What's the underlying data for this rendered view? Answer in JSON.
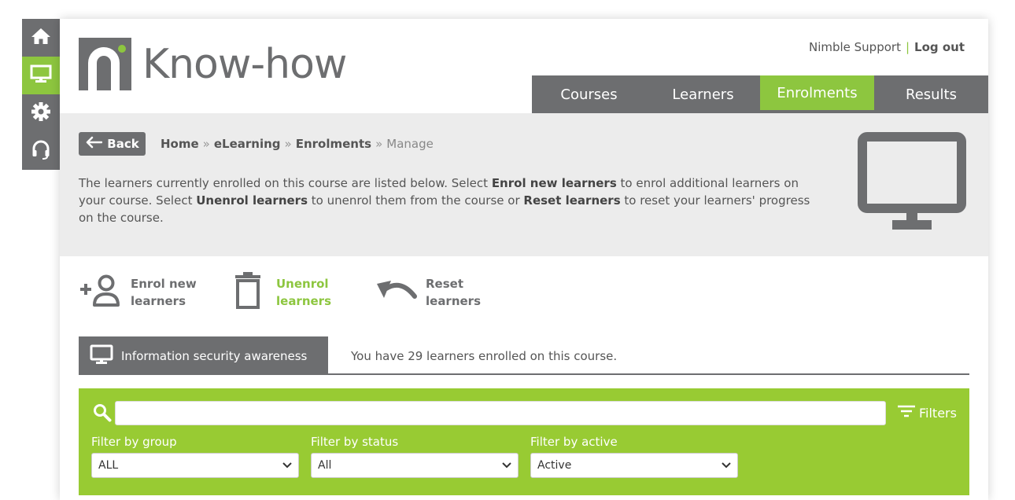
{
  "sidenav": {
    "items": [
      {
        "icon": "home-icon"
      },
      {
        "icon": "monitor-icon",
        "active": true
      },
      {
        "icon": "gear-icon"
      },
      {
        "icon": "headset-icon"
      }
    ]
  },
  "brand": {
    "name": "Know-how"
  },
  "top_links": {
    "support": "Nimble Support",
    "separator": "|",
    "logout": "Log out"
  },
  "mainnav": {
    "items": [
      {
        "label": "Courses"
      },
      {
        "label": "Learners"
      },
      {
        "label": "Enrolments",
        "active": true
      },
      {
        "label": "Results"
      }
    ]
  },
  "back_button": {
    "label": "Back"
  },
  "breadcrumb": {
    "items": [
      "Home",
      "eLearning",
      "Enrolments"
    ],
    "current": "Manage",
    "separator": "»"
  },
  "intro": {
    "t1": "The learners currently enrolled on this course are listed below. Select ",
    "b1": "Enrol new learners",
    "t2": " to enrol additional learners on your course. Select ",
    "b2": "Unenrol learners",
    "t3": " to unenrol them from the course or ",
    "b3": "Reset learners",
    "t4": " to reset your learners' progress on the course."
  },
  "actions": {
    "enrol": {
      "line1": "Enrol new",
      "line2": "learners"
    },
    "unenrol": {
      "line1": "Unenrol",
      "line2": "learners"
    },
    "reset": {
      "line1": "Reset",
      "line2": "learners"
    }
  },
  "course": {
    "name": "Information security awareness",
    "enrolled_text": "You have 29 learners enrolled on this course."
  },
  "search": {
    "value": "",
    "placeholder": ""
  },
  "filters": {
    "button_label": "Filters",
    "group": {
      "label": "Filter by group",
      "value": "ALL"
    },
    "status": {
      "label": "Filter by status",
      "value": "All"
    },
    "active": {
      "label": "Filter by active",
      "value": "Active"
    }
  },
  "colors": {
    "accent": "#8dc63f",
    "panel_green": "#98cb33",
    "dark_gray": "#6d6e70",
    "light_gray": "#ececec"
  }
}
